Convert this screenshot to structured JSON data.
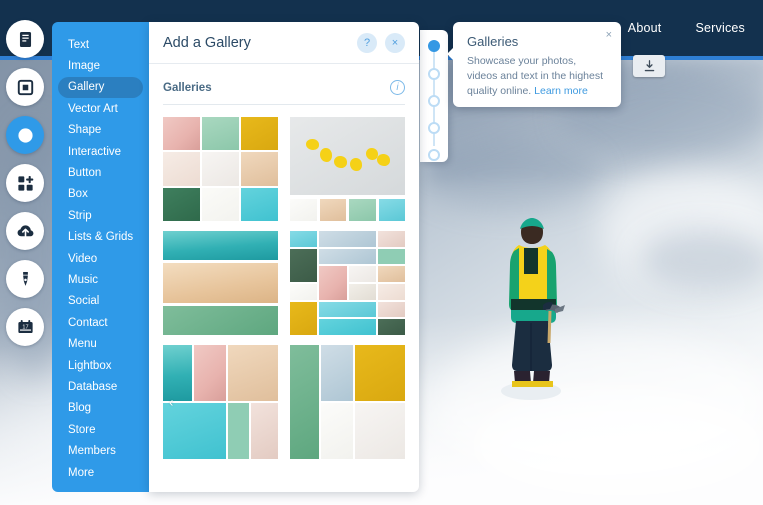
{
  "site": {
    "nav_links": [
      "About",
      "Services"
    ],
    "download_icon": "download-icon"
  },
  "rail": {
    "items": [
      {
        "name": "pages-icon",
        "label": "Pages"
      },
      {
        "name": "background-icon",
        "label": "Background"
      },
      {
        "name": "add-icon",
        "label": "Add",
        "active": true
      },
      {
        "name": "apps-icon",
        "label": "Add Apps"
      },
      {
        "name": "upload-icon",
        "label": "My Uploads"
      },
      {
        "name": "design-icon",
        "label": "Design"
      },
      {
        "name": "bookings-icon",
        "label": "Bookings"
      }
    ]
  },
  "category_menu": {
    "items": [
      {
        "label": "Text"
      },
      {
        "label": "Image"
      },
      {
        "label": "Gallery",
        "selected": true
      },
      {
        "label": "Vector Art"
      },
      {
        "label": "Shape"
      },
      {
        "label": "Interactive"
      },
      {
        "label": "Button"
      },
      {
        "label": "Box"
      },
      {
        "label": "Strip"
      },
      {
        "label": "Lists & Grids"
      },
      {
        "label": "Video"
      },
      {
        "label": "Music"
      },
      {
        "label": "Social"
      },
      {
        "label": "Contact"
      },
      {
        "label": "Menu"
      },
      {
        "label": "Lightbox"
      },
      {
        "label": "Database"
      },
      {
        "label": "Blog"
      },
      {
        "label": "Store"
      },
      {
        "label": "Members"
      },
      {
        "label": "More"
      }
    ]
  },
  "panel": {
    "title": "Add a Gallery",
    "help_label": "?",
    "close_label": "×",
    "section_title": "Galleries",
    "info_label": "i",
    "galleries": [
      {
        "name": "grid-gallery",
        "layout": "grid-3x3"
      },
      {
        "name": "slider-gallery",
        "layout": "hero-strip"
      },
      {
        "name": "stacked-gallery",
        "layout": "bands"
      },
      {
        "name": "collage-gallery",
        "layout": "mosaic"
      },
      {
        "name": "masonry-gallery",
        "layout": "wide-mosaic"
      },
      {
        "name": "thumbnail-gallery",
        "layout": "wide-mosaic-2"
      }
    ],
    "prev_arrow": "‹"
  },
  "slider": {
    "dots": [
      true,
      false,
      false,
      false,
      false
    ]
  },
  "tooltip": {
    "title": "Galleries",
    "body": "Showcase your photos, videos and text in the highest quality online. ",
    "link": "Learn more",
    "close_label": "×"
  },
  "colors": {
    "accent_blue": "#2f9ae8",
    "menu_selected": "#2b7fc0",
    "navy": "#13314e",
    "panel_bg": "#ffffff",
    "link_blue": "#3e9ae0"
  }
}
